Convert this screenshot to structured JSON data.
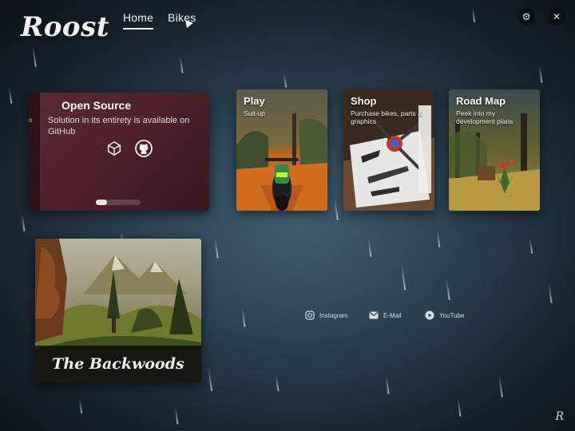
{
  "app": {
    "logo_text": "Roost",
    "corner_mark": "R"
  },
  "nav": {
    "items": [
      {
        "label": "Home",
        "active": true
      },
      {
        "label": "Bikes",
        "active": false
      }
    ]
  },
  "window_controls": {
    "settings_icon": "gear-icon",
    "close_icon": "close-icon"
  },
  "open_source": {
    "title": "Open Source",
    "description": "Solution in its entirety is available on GitHub",
    "edge_label": "o",
    "icons": [
      "unity-icon",
      "github-icon"
    ],
    "pager": {
      "count": 4,
      "active_index": 0
    }
  },
  "cards": [
    {
      "title": "Play",
      "subtitle": "Suit-up"
    },
    {
      "title": "Shop",
      "subtitle": "Purchase bikes, parts & graphics"
    },
    {
      "title": "Road Map",
      "subtitle": "Peek into my development plans"
    }
  ],
  "world": {
    "title": "The Backwoods"
  },
  "social": [
    {
      "label": "Instagram",
      "icon": "instagram-icon"
    },
    {
      "label": "E-Mail",
      "icon": "mail-icon"
    },
    {
      "label": "YouTube",
      "icon": "youtube-icon"
    }
  ],
  "colors": {
    "open_source_card": "#5e2a34",
    "background": "#2a4050",
    "accent": "#e8e8e8"
  }
}
